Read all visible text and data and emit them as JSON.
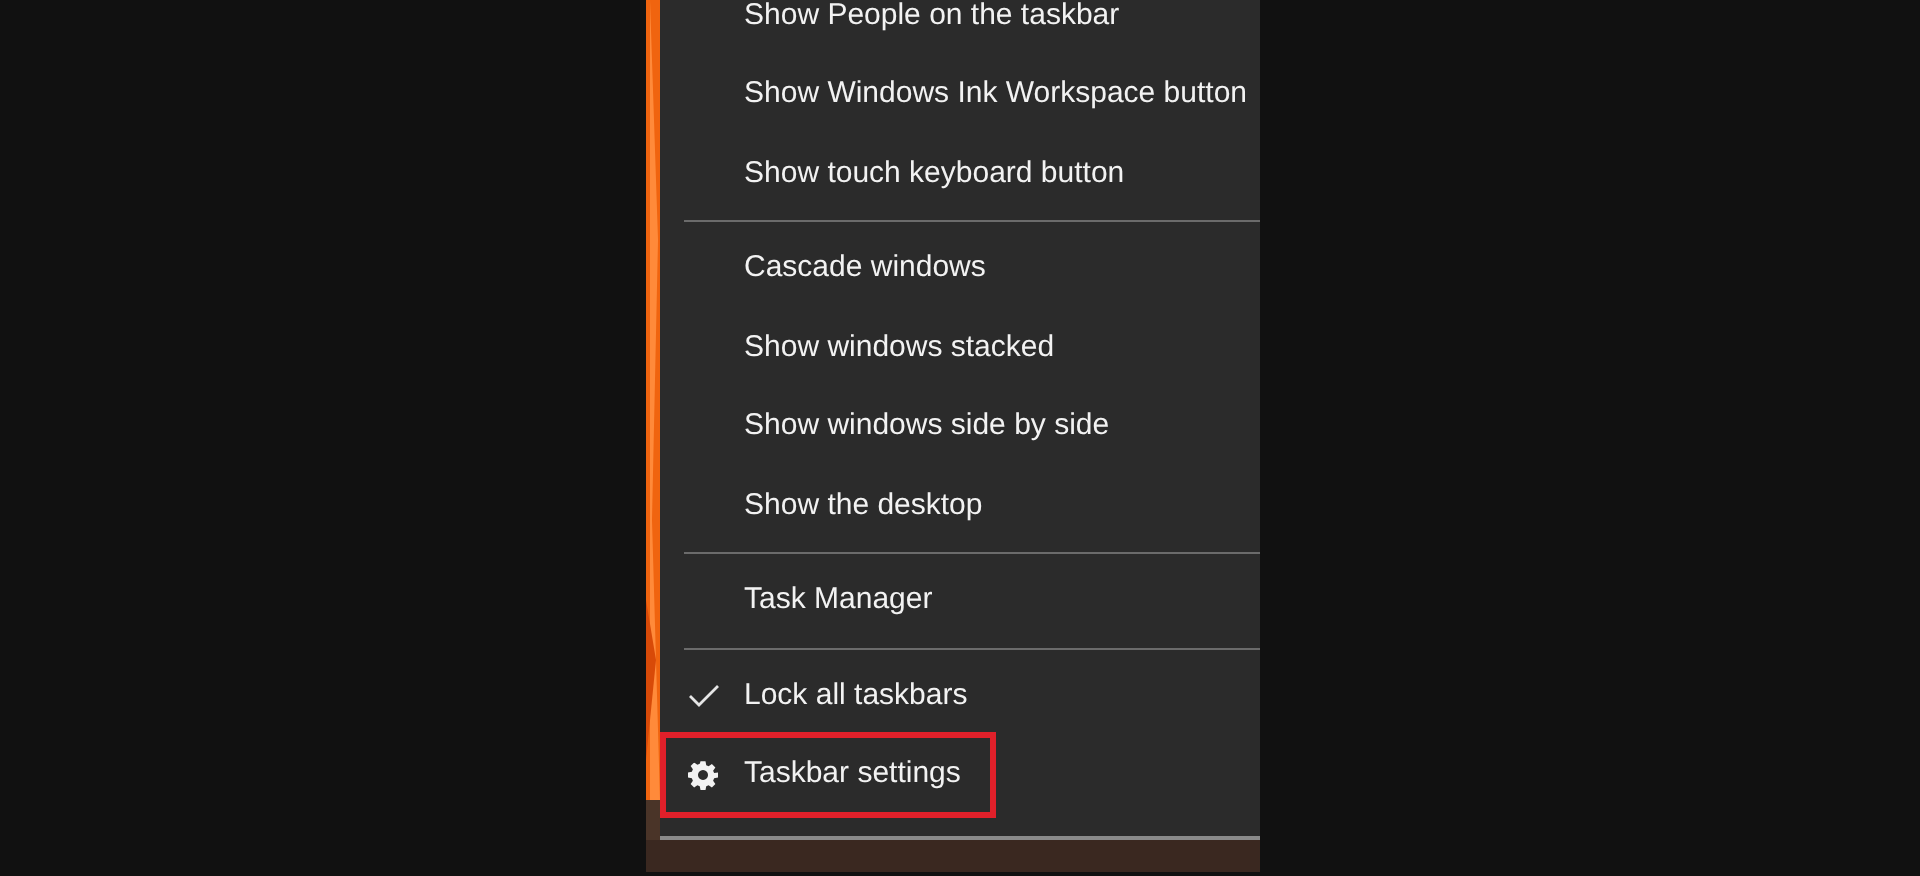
{
  "menu": {
    "items": [
      {
        "kind": "item",
        "label": "Show People on the taskbar",
        "checked": false,
        "highlighted": false
      },
      {
        "kind": "item",
        "label": "Show Windows Ink Workspace button",
        "checked": false,
        "highlighted": false
      },
      {
        "kind": "item",
        "label": "Show touch keyboard button",
        "checked": false,
        "highlighted": false
      },
      {
        "kind": "separator"
      },
      {
        "kind": "item",
        "label": "Cascade windows",
        "checked": false,
        "highlighted": false
      },
      {
        "kind": "item",
        "label": "Show windows stacked",
        "checked": false,
        "highlighted": false
      },
      {
        "kind": "item",
        "label": "Show windows side by side",
        "checked": false,
        "highlighted": false
      },
      {
        "kind": "item",
        "label": "Show the desktop",
        "checked": false,
        "highlighted": false
      },
      {
        "kind": "separator"
      },
      {
        "kind": "item",
        "label": "Task Manager",
        "checked": false,
        "highlighted": false
      },
      {
        "kind": "separator"
      },
      {
        "kind": "item",
        "label": "Lock all taskbars",
        "checked": true,
        "highlighted": false
      },
      {
        "kind": "settings_item",
        "label": "Taskbar settings",
        "checked": false,
        "highlighted": true
      }
    ]
  }
}
